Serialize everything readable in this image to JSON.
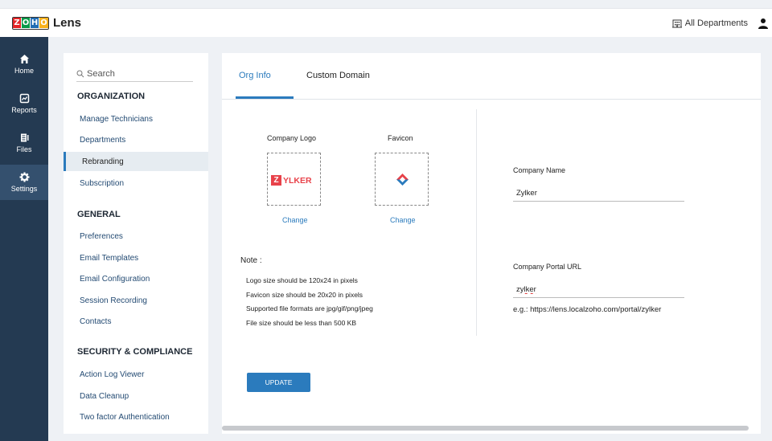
{
  "app": {
    "name": "Lens",
    "brand_letters": [
      "Z",
      "O",
      "H",
      "O"
    ]
  },
  "topbar": {
    "departments_label": "All Departments"
  },
  "rail": [
    {
      "label": "Home"
    },
    {
      "label": "Reports"
    },
    {
      "label": "Files"
    },
    {
      "label": "Settings"
    }
  ],
  "menu": {
    "search_placeholder": "Search",
    "sections": [
      {
        "title": "ORGANIZATION",
        "items": [
          "Manage Technicians",
          "Departments",
          "Rebranding",
          "Subscription"
        ]
      },
      {
        "title": "GENERAL",
        "items": [
          "Preferences",
          "Email Templates",
          "Email Configuration",
          "Session Recording",
          "Contacts"
        ]
      },
      {
        "title": "SECURITY & COMPLIANCE",
        "items": [
          "Action Log Viewer",
          "Data Cleanup",
          "Two factor Authentication"
        ]
      }
    ],
    "active_item": "Rebranding"
  },
  "tabs": [
    {
      "label": "Org Info"
    },
    {
      "label": "Custom Domain"
    }
  ],
  "branding": {
    "company_logo_label": "Company Logo",
    "favicon_label": "Favicon",
    "logo_text": "YLKER",
    "logo_mark": "Z",
    "change_label": "Change",
    "accent_red": "#e8424a"
  },
  "note": {
    "title": "Note :",
    "lines": [
      "Logo size should be 120x24 in pixels",
      "Favicon size should be 20x20 in pixels",
      "Supported file formats are jpg/gif/png/jpeg",
      "File size should be less than 500 KB"
    ]
  },
  "fields": {
    "company_name_label": "Company Name",
    "company_name_value": "Zylker",
    "portal_url_label": "Company Portal URL",
    "portal_url_value": "zylker",
    "portal_url_example": "e.g.: https://lens.localzoho.com/portal/zylker"
  },
  "actions": {
    "update_label": "UPDATE"
  }
}
